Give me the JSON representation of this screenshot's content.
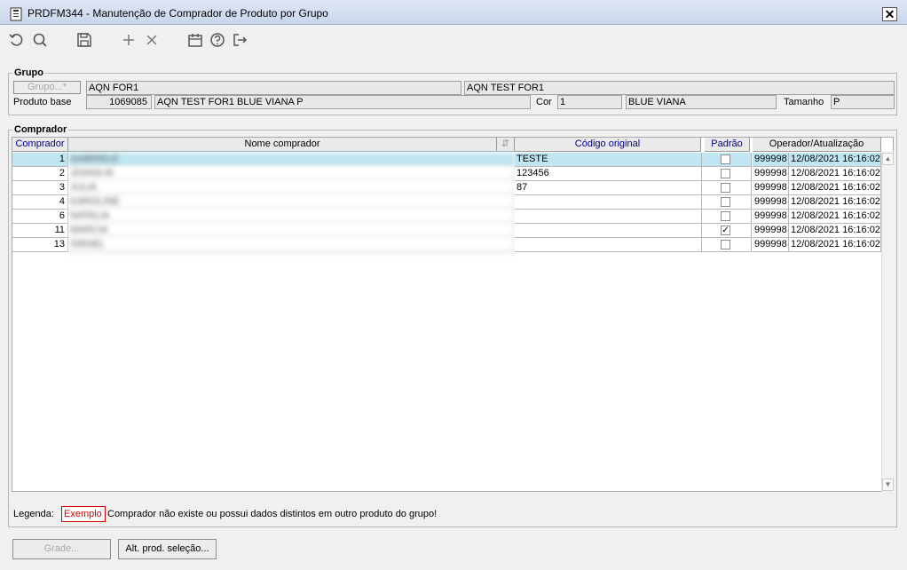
{
  "window": {
    "title": "PRDFM344 - Manutenção de Comprador de Produto por Grupo",
    "close_symbol": "✕"
  },
  "toolbar": [
    "undo-icon",
    "search-icon",
    "save-icon",
    "add-icon",
    "delete-icon",
    "calendar-icon",
    "help-icon",
    "exit-icon"
  ],
  "grupo": {
    "legend": "Grupo",
    "grupo_button": "Grupo...*",
    "grupo_value1": "AQN FOR1",
    "grupo_value2": "AQN TEST FOR1",
    "produto_base_label": "Produto base",
    "produto_code": "1069085",
    "produto_desc": "AQN TEST FOR1 BLUE VIANA P",
    "cor_label": "Cor",
    "cor_code": "1",
    "cor_desc": "BLUE VIANA",
    "tamanho_label": "Tamanho",
    "tamanho_value": "P"
  },
  "comprador": {
    "legend": "Comprador",
    "columns": {
      "comprador": "Comprador",
      "nome": "Nome comprador",
      "codigo": "Código original",
      "padrao": "Padrão",
      "operador": "Operador/Atualização"
    },
    "rows": [
      {
        "id": "1",
        "nome": "GABRIELE",
        "codigo": "TESTE",
        "padrao": false,
        "operador": "999998",
        "data": "12/08/2021 16:16:02"
      },
      {
        "id": "2",
        "nome": "JOANA M",
        "codigo": "123456",
        "padrao": false,
        "operador": "999998",
        "data": "12/08/2021 16:16:02"
      },
      {
        "id": "3",
        "nome": "JULIA",
        "codigo": "87",
        "padrao": false,
        "operador": "999998",
        "data": "12/08/2021 16:16:02"
      },
      {
        "id": "4",
        "nome": "KAROLINE",
        "codigo": "",
        "padrao": false,
        "operador": "999998",
        "data": "12/08/2021 16:16:02"
      },
      {
        "id": "6",
        "nome": "NATALIA",
        "codigo": "",
        "padrao": false,
        "operador": "999998",
        "data": "12/08/2021 16:16:02"
      },
      {
        "id": "11",
        "nome": "MARCIA",
        "codigo": "",
        "padrao": true,
        "operador": "999998",
        "data": "12/08/2021 16:16:02"
      },
      {
        "id": "13",
        "nome": "ISRAEL",
        "codigo": "",
        "padrao": false,
        "operador": "999998",
        "data": "12/08/2021 16:16:02"
      }
    ]
  },
  "legenda": {
    "label": "Legenda:",
    "example": "Exemplo",
    "text": "Comprador não existe ou possui dados distintos em outro produto do grupo!"
  },
  "buttons": {
    "grade": "Grade...",
    "alt_prod": "Alt. prod. seleção..."
  },
  "colors": {
    "selected_row": "#bfe6f2",
    "header_text": "#00008b",
    "example_red": "#d00000"
  }
}
